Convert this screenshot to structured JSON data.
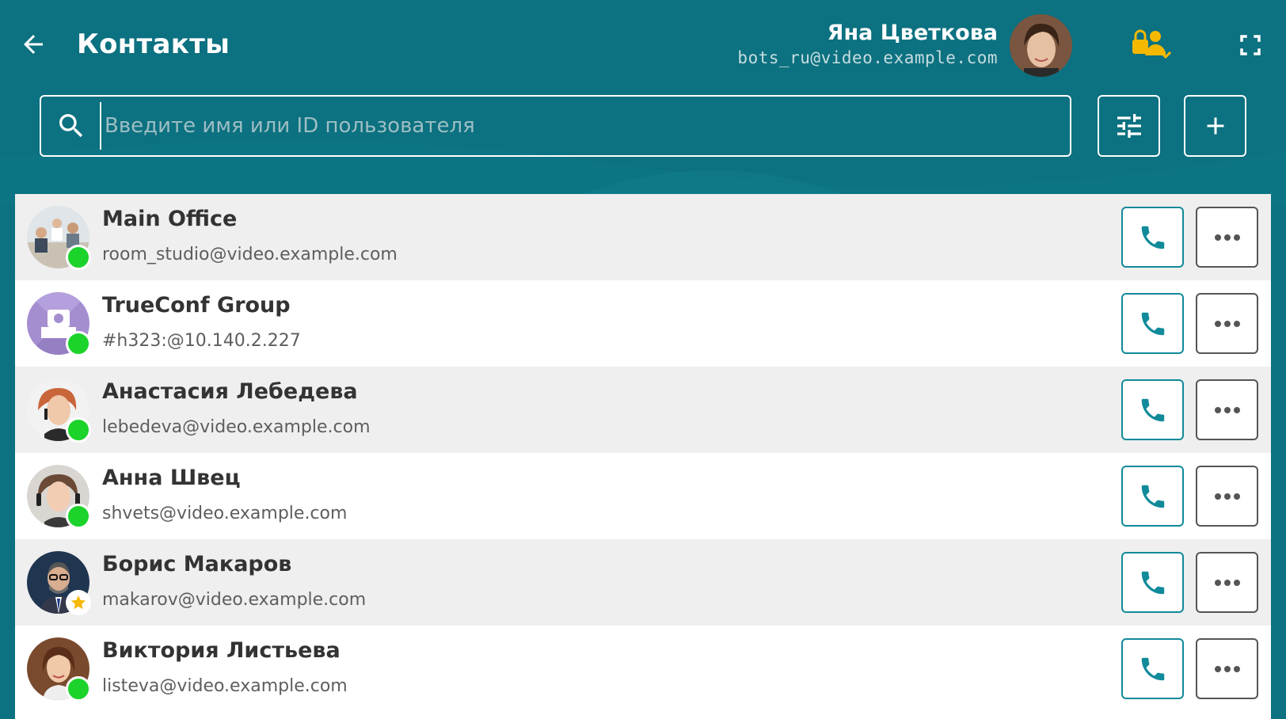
{
  "header": {
    "title": "Контакты",
    "back_icon": "arrow-left-icon",
    "user": {
      "name": "Яна Цветкова",
      "email": "bots_ru@video.example.com"
    },
    "status_icon": "user-lock-icon",
    "fullscreen_icon": "fullscreen-icon"
  },
  "search": {
    "placeholder": "Введите имя или ID пользователя",
    "value": "",
    "icon": "search-icon"
  },
  "toolbar": {
    "filter_icon": "sliders-icon",
    "add_icon": "plus-icon"
  },
  "contacts": [
    {
      "name": "Main Office",
      "id": "room_studio@video.example.com",
      "status": "online"
    },
    {
      "name": "TrueConf Group",
      "id": "#h323:@10.140.2.227",
      "status": "online"
    },
    {
      "name": "Анастасия Лебедева",
      "id": "lebedeva@video.example.com",
      "status": "online"
    },
    {
      "name": "Анна Швец",
      "id": "shvets@video.example.com",
      "status": "online"
    },
    {
      "name": "Борис Макаров",
      "id": "makarov@video.example.com",
      "status": "favorite"
    },
    {
      "name": "Виктория Листьева",
      "id": "listeva@video.example.com",
      "status": "online"
    }
  ],
  "colors": {
    "header_bg": "#0c7180",
    "online": "#1bd32b",
    "accent": "#118a9a",
    "lock_icon": "#f5b800"
  }
}
